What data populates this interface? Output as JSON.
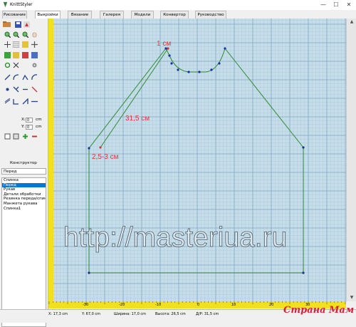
{
  "window": {
    "title": "KnittStyler",
    "minimize": "—",
    "maximize": "☐",
    "close": "✕"
  },
  "tabs": [
    "Рисование",
    "Выкройки",
    "Вязание",
    "Галерея",
    "Модели",
    "Конвертор",
    "Руководство"
  ],
  "active_tab": "Выкройки",
  "left_panel": {
    "x_label": "X:",
    "x_value": "0",
    "x_unit": "cm",
    "y_label": "Y:",
    "y_value": "0",
    "y_unit": "cm",
    "constructor_label": "Конструктор",
    "part_name": "Перед",
    "parts": [
      "Спинка",
      "Перед",
      "Рукав",
      "Детали обработки",
      "Резинка переда/спин",
      "Манжета рукава",
      "Спинка1"
    ],
    "selected_part": "Перед"
  },
  "annotations": {
    "one_cm": "1 см",
    "length": "31,5 см",
    "width": "2,5-3 см"
  },
  "watermark": "http://masteriua.ru",
  "ruler_labels": [
    "-30",
    "-20",
    "-10",
    "0",
    "10",
    "20",
    "30"
  ],
  "status": {
    "x": "X: 17,3 cm",
    "y": "Y: 67,0 cm",
    "width": "Ширина: 17,0 cm",
    "height": "Высота: 26,5 cm",
    "length": "Д/Р: 31,5 cm"
  },
  "brand": "Страна Мам",
  "colors": {
    "grid_bg": "#c5dde9",
    "grid_major": "#7fa6c3",
    "grid_minor": "#a9c7da",
    "pattern_line": "#2e8b2e",
    "point": "#1a2f9e",
    "annotation": "#e0353f",
    "ruler": "#f0e020"
  }
}
